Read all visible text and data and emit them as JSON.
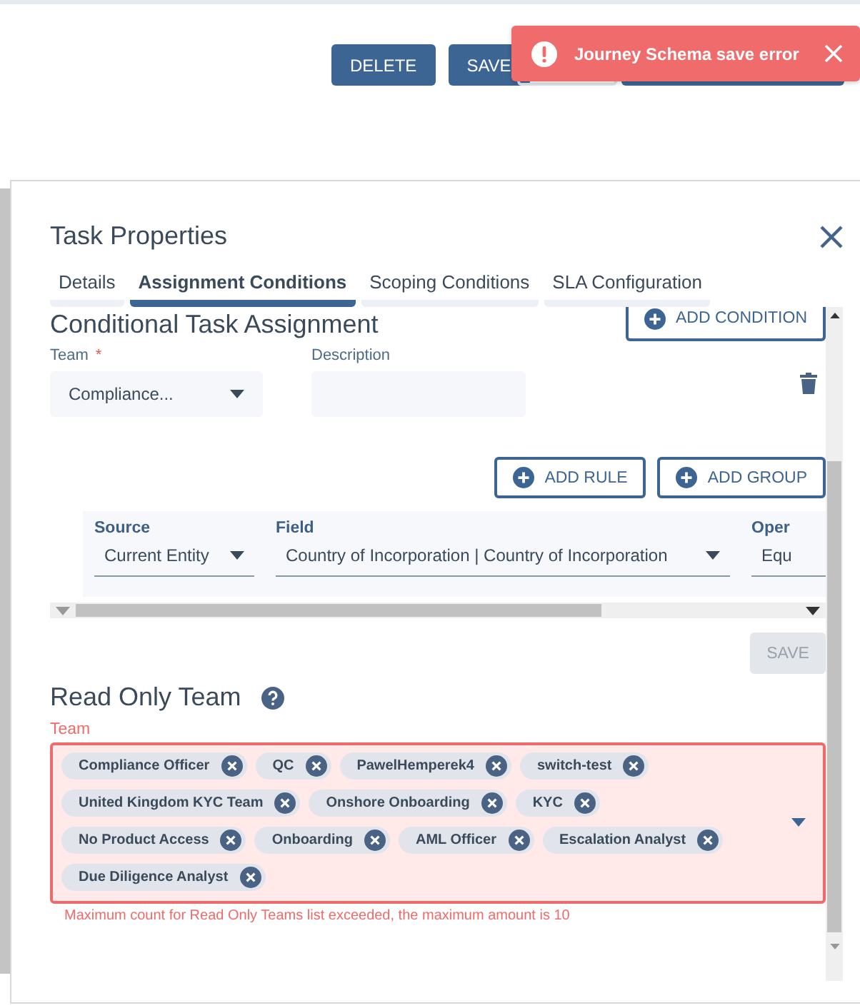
{
  "toolbar": {
    "buttons": [
      {
        "label": "DELETE"
      },
      {
        "label": "SAVE"
      }
    ]
  },
  "toast": {
    "kind": "error",
    "message": "Journey Schema save error"
  },
  "dialog": {
    "title": "Task Properties",
    "tabs": [
      {
        "label": "Details",
        "selected": false
      },
      {
        "label": "Assignment Conditions",
        "selected": true
      },
      {
        "label": "Scoping Conditions",
        "selected": false
      },
      {
        "label": "SLA Configuration",
        "selected": false
      }
    ],
    "conditional_assignment": {
      "heading": "Conditional Task Assignment",
      "add_condition": "ADD CONDITION",
      "team": {
        "label": "Team",
        "required_mark": "*",
        "value": "Compliance..."
      },
      "description": {
        "label": "Description"
      },
      "add_rule": "ADD RULE",
      "add_group": "ADD GROUP",
      "rule_columns": [
        {
          "label": "Source",
          "value": "Current Entity"
        },
        {
          "label": "Field",
          "value": "Country of Incorporation | Country of Incorporation"
        },
        {
          "label": "Oper",
          "value": "Equ"
        }
      ],
      "save": {
        "label": "SAVE",
        "disabled": true
      }
    },
    "read_only_team": {
      "heading": "Read Only Team",
      "field": {
        "label": "Team",
        "invalid": true,
        "tags": [
          "Compliance Officer",
          "QC",
          "PawelHemperek4",
          "switch-test",
          "United Kingdom KYC Team",
          "Onshore Onboarding",
          "KYC",
          "No Product Access",
          "Onboarding",
          "AML Officer",
          "Escalation Analyst",
          "Due Diligence Analyst"
        ],
        "error": "Maximum count for Read Only Teams list exceeded, the maximum amount is 10"
      }
    }
  }
}
